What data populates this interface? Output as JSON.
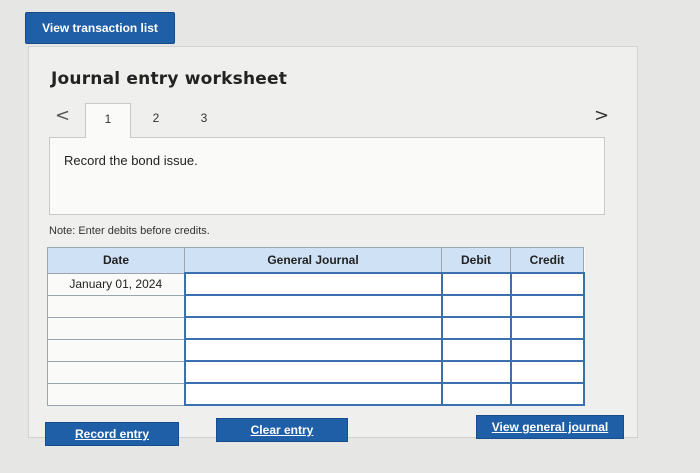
{
  "top_button": {
    "label": "View transaction list"
  },
  "worksheet": {
    "title": "Journal entry worksheet",
    "prev_icon": "<",
    "next_icon": ">",
    "tabs": [
      {
        "label": "1"
      },
      {
        "label": "2"
      },
      {
        "label": "3"
      }
    ],
    "active_tab": "1",
    "description": "Record the bond issue.",
    "note": "Note: Enter debits before credits."
  },
  "table": {
    "headers": {
      "date": "Date",
      "journal": "General Journal",
      "debit": "Debit",
      "credit": "Credit"
    },
    "rows": [
      {
        "date": "January 01, 2024",
        "journal": "",
        "debit": "",
        "credit": ""
      },
      {
        "date": "",
        "journal": "",
        "debit": "",
        "credit": ""
      },
      {
        "date": "",
        "journal": "",
        "debit": "",
        "credit": ""
      },
      {
        "date": "",
        "journal": "",
        "debit": "",
        "credit": ""
      },
      {
        "date": "",
        "journal": "",
        "debit": "",
        "credit": ""
      },
      {
        "date": "",
        "journal": "",
        "debit": "",
        "credit": ""
      }
    ]
  },
  "buttons": {
    "record": "Record entry",
    "clear": "Clear entry",
    "view_journal": "View general journal"
  },
  "colors": {
    "primary_button": "#1f5fa8",
    "header_bg": "#cfe1f5",
    "input_border": "#3c6fb0"
  }
}
